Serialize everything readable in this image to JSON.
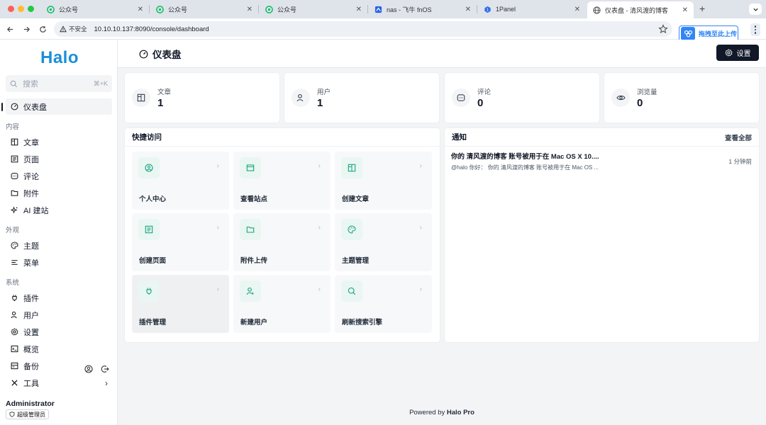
{
  "browser": {
    "tabs": [
      {
        "title": "公众号",
        "icon": "wechat-icon"
      },
      {
        "title": "公众号",
        "icon": "wechat-icon"
      },
      {
        "title": "公众号",
        "icon": "wechat-icon"
      },
      {
        "title": "nas - 飞牛 fnOS",
        "icon": "fnos-icon"
      },
      {
        "title": "1Panel",
        "icon": "1panel-icon"
      },
      {
        "title": "仪表盘 - 清风渡的博客",
        "icon": "globe-icon",
        "active": true
      }
    ],
    "new_tab": "+",
    "insecure_label": "不安全",
    "url": "10.10.10.137:8090/console/dashboard",
    "extension_label": "拖拽至此上传"
  },
  "sidebar": {
    "logo": "Halo",
    "search_placeholder": "搜索",
    "search_shortcut": "⌘+K",
    "items": [
      {
        "label": "仪表盘",
        "icon": "dashboard-icon"
      },
      {
        "label": "文章",
        "icon": "post-icon"
      },
      {
        "label": "页面",
        "icon": "page-icon"
      },
      {
        "label": "评论",
        "icon": "comment-icon"
      },
      {
        "label": "附件",
        "icon": "folder-icon"
      },
      {
        "label": "AI 建站",
        "icon": "sparkle-icon"
      },
      {
        "label": "主题",
        "icon": "palette-icon"
      },
      {
        "label": "菜单",
        "icon": "menu-icon"
      },
      {
        "label": "插件",
        "icon": "plug-icon"
      },
      {
        "label": "用户",
        "icon": "user-icon"
      },
      {
        "label": "设置",
        "icon": "gear-icon"
      },
      {
        "label": "概览",
        "icon": "terminal-icon"
      },
      {
        "label": "备份",
        "icon": "backup-icon"
      },
      {
        "label": "工具",
        "icon": "tools-icon"
      }
    ],
    "groups": [
      "内容",
      "外观",
      "系统"
    ],
    "user": {
      "name": "Administrator",
      "role": "超级管理员"
    }
  },
  "header": {
    "title": "仪表盘",
    "settings_label": "设置"
  },
  "stats": [
    {
      "label": "文章",
      "value": "1",
      "icon": "post-icon"
    },
    {
      "label": "用户",
      "value": "1",
      "icon": "user-icon"
    },
    {
      "label": "评论",
      "value": "0",
      "icon": "comment-icon"
    },
    {
      "label": "浏览量",
      "value": "0",
      "icon": "eye-icon"
    }
  ],
  "quick_access": {
    "title": "快捷访问",
    "items": [
      {
        "label": "个人中心",
        "icon": "user-circle-icon"
      },
      {
        "label": "查看站点",
        "icon": "browser-icon"
      },
      {
        "label": "创建文章",
        "icon": "post-icon"
      },
      {
        "label": "创建页面",
        "icon": "page-icon"
      },
      {
        "label": "附件上传",
        "icon": "folder-icon"
      },
      {
        "label": "主题管理",
        "icon": "palette-icon"
      },
      {
        "label": "插件管理",
        "icon": "plug-icon"
      },
      {
        "label": "新建用户",
        "icon": "user-plus-icon"
      },
      {
        "label": "刷新搜索引擎",
        "icon": "search-icon"
      }
    ]
  },
  "notifications": {
    "title": "通知",
    "view_all": "查看全部",
    "items": [
      {
        "title": "你的 清风渡的博客 账号被用于在 Mac OS X 10....",
        "desc": "@halo 你好： 你的 清风渡的博客 账号被用于在 Mac OS ...",
        "time": "1 分钟前"
      }
    ]
  },
  "footer": {
    "prefix": "Powered by ",
    "brand": "Halo Pro"
  },
  "colors": {
    "accent": "#16a37f",
    "primary_button": "#111827",
    "logo": "#1a8fd8"
  }
}
